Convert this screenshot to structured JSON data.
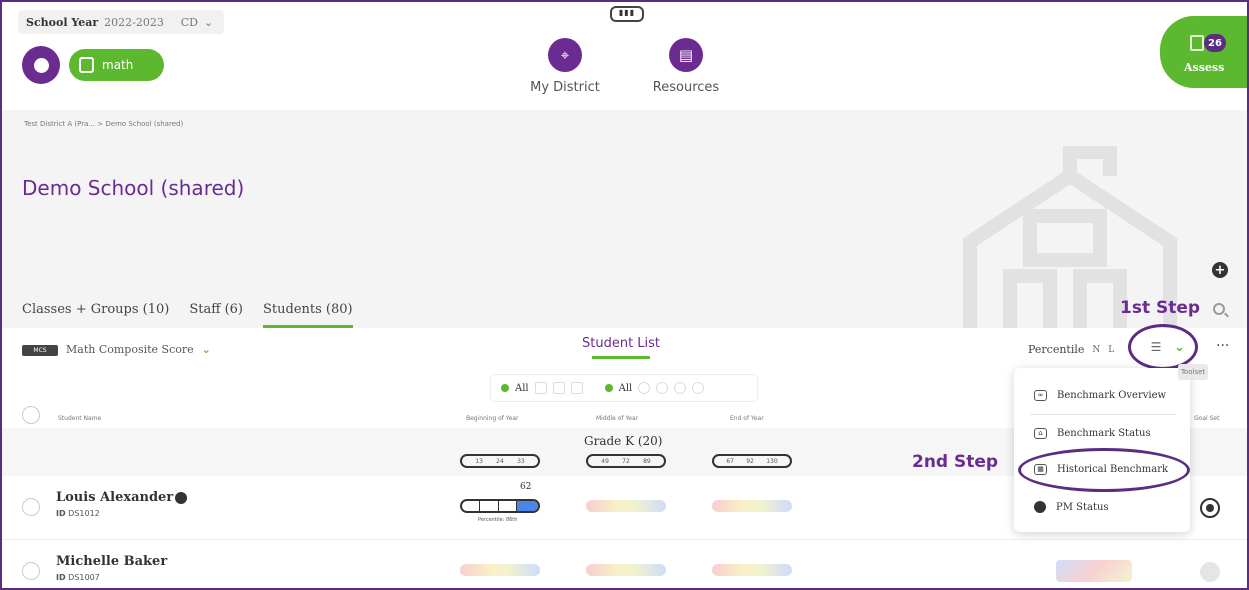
{
  "header": {
    "school_year_label": "School Year",
    "school_year_value": "2022-2023",
    "district_code": "CD",
    "app_subject": "math",
    "nav": [
      {
        "label": "My District",
        "icon": "location-pin-icon"
      },
      {
        "label": "Resources",
        "icon": "document-icon"
      }
    ],
    "assess": {
      "label": "Assess",
      "badge": "26"
    }
  },
  "hero": {
    "breadcrumb": "Test District A (Pra... > Demo School (shared)",
    "title": "Demo School (shared)",
    "tabs": [
      {
        "label": "Classes + Groups (10)",
        "active": false
      },
      {
        "label": "Staff (6)",
        "active": false
      },
      {
        "label": "Students (80)",
        "active": true
      }
    ]
  },
  "annotations": {
    "step1": "1st Step",
    "step2": "2nd Step"
  },
  "toolbar": {
    "score_badge": "MCS",
    "score_select": "Math Composite Score",
    "list_title": "Student List",
    "percentile_label": "Percentile",
    "percentile_options": [
      "N",
      "L"
    ]
  },
  "filters": {
    "all_1": "All",
    "all_2": "All"
  },
  "table": {
    "columns": [
      "Student Name",
      "Beginning of Year",
      "Middle of Year",
      "End of Year",
      "Goal Set"
    ],
    "grade_group": "Grade K (20)",
    "ranges": {
      "boy": [
        "13",
        "24",
        "33"
      ],
      "moy": [
        "49",
        "72",
        "89"
      ],
      "eoy": [
        "67",
        "92",
        "130"
      ]
    },
    "students": [
      {
        "name": "Louis Alexander",
        "id_label": "ID",
        "id": "DS1012",
        "boy_score": "62",
        "percentile_label": "Percentile: 86th"
      },
      {
        "name": "Michelle Baker",
        "id_label": "ID",
        "id": "DS1007"
      }
    ]
  },
  "dropdown": {
    "tooltip": "Toolset",
    "items": [
      {
        "label": "Benchmark Overview",
        "icon": "overview-icon"
      },
      {
        "label": "Benchmark Status",
        "icon": "status-icon"
      },
      {
        "label": "Historical Benchmark",
        "icon": "calendar-icon"
      },
      {
        "label": "PM Status",
        "icon": "pm-icon"
      }
    ]
  },
  "colors": {
    "primary_purple": "#6b2c91",
    "accent_green": "#5cb82e",
    "annotation_purple": "#5a2d82"
  }
}
